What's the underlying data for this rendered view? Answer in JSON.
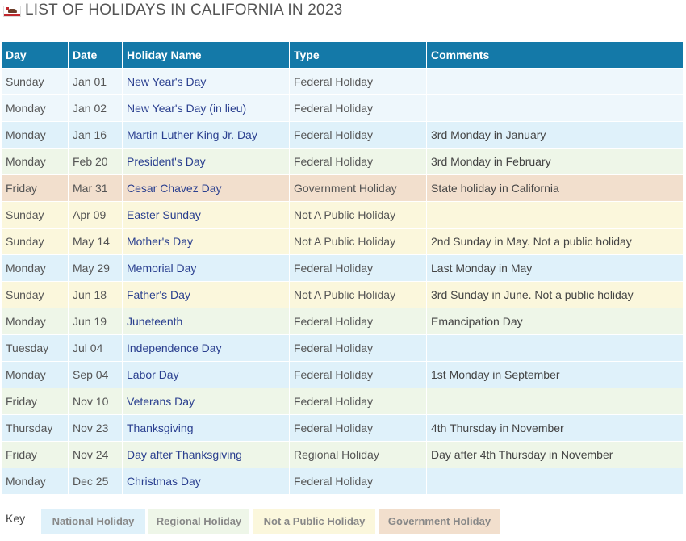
{
  "header": {
    "title": "LIST OF HOLIDAYS IN CALIFORNIA IN 2023",
    "flag_icon": "california-flag-icon"
  },
  "table": {
    "columns": [
      "Day",
      "Date",
      "Holiday Name",
      "Type",
      "Comments"
    ],
    "rows": [
      {
        "day": "Sunday",
        "date": "Jan 01",
        "name": "New Year's Day",
        "type": "Federal Holiday",
        "comment": "",
        "style": "federal-plain"
      },
      {
        "day": "Monday",
        "date": "Jan 02",
        "name": "New Year's Day (in lieu)",
        "type": "Federal Holiday",
        "comment": "",
        "style": "federal-plain"
      },
      {
        "day": "Monday",
        "date": "Jan 16",
        "name": "Martin Luther King Jr. Day",
        "type": "Federal Holiday",
        "comment": "3rd Monday in January",
        "style": "federal"
      },
      {
        "day": "Monday",
        "date": "Feb 20",
        "name": "President's Day",
        "type": "Federal Holiday",
        "comment": "3rd Monday in February",
        "style": "federal-green"
      },
      {
        "day": "Friday",
        "date": "Mar 31",
        "name": "Cesar Chavez Day",
        "type": "Government Holiday",
        "comment": "State holiday in California",
        "style": "government"
      },
      {
        "day": "Sunday",
        "date": "Apr 09",
        "name": "Easter Sunday",
        "type": "Not A Public Holiday",
        "comment": "",
        "style": "notpublic"
      },
      {
        "day": "Sunday",
        "date": "May 14",
        "name": "Mother's Day",
        "type": "Not A Public Holiday",
        "comment": "2nd Sunday in May. Not a public holiday",
        "style": "notpublic"
      },
      {
        "day": "Monday",
        "date": "May 29",
        "name": "Memorial Day",
        "type": "Federal Holiday",
        "comment": "Last Monday in May",
        "style": "federal"
      },
      {
        "day": "Sunday",
        "date": "Jun 18",
        "name": "Father's Day",
        "type": "Not A Public Holiday",
        "comment": "3rd Sunday in June. Not a public holiday",
        "style": "notpublic"
      },
      {
        "day": "Monday",
        "date": "Jun 19",
        "name": "Juneteenth",
        "type": "Federal Holiday",
        "comment": "Emancipation Day",
        "style": "federal-green"
      },
      {
        "day": "Tuesday",
        "date": "Jul 04",
        "name": "Independence Day",
        "type": "Federal Holiday",
        "comment": "",
        "style": "federal"
      },
      {
        "day": "Monday",
        "date": "Sep 04",
        "name": "Labor Day",
        "type": "Federal Holiday",
        "comment": "1st Monday in September",
        "style": "federal"
      },
      {
        "day": "Friday",
        "date": "Nov 10",
        "name": "Veterans Day",
        "type": "Federal Holiday",
        "comment": "",
        "style": "federal-green"
      },
      {
        "day": "Thursday",
        "date": "Nov 23",
        "name": "Thanksgiving",
        "type": "Federal Holiday",
        "comment": "4th Thursday in November",
        "style": "federal"
      },
      {
        "day": "Friday",
        "date": "Nov 24",
        "name": "Day after Thanksgiving",
        "type": "Regional Holiday",
        "comment": "Day after 4th Thursday in November",
        "style": "regional"
      },
      {
        "day": "Monday",
        "date": "Dec 25",
        "name": "Christmas Day",
        "type": "Federal Holiday",
        "comment": "",
        "style": "federal"
      }
    ]
  },
  "key": {
    "label": "Key",
    "items": [
      {
        "label": "National Holiday",
        "color": "#dff1fa"
      },
      {
        "label": "Regional Holiday",
        "color": "#eef6e8"
      },
      {
        "label": "Not a Public Holiday",
        "color": "#fbf7dc"
      },
      {
        "label": "Government Holiday",
        "color": "#f2dfcd"
      }
    ]
  },
  "colors": {
    "header_bg": "#1479a8",
    "holiday_name_text": "#2a3f8f"
  }
}
